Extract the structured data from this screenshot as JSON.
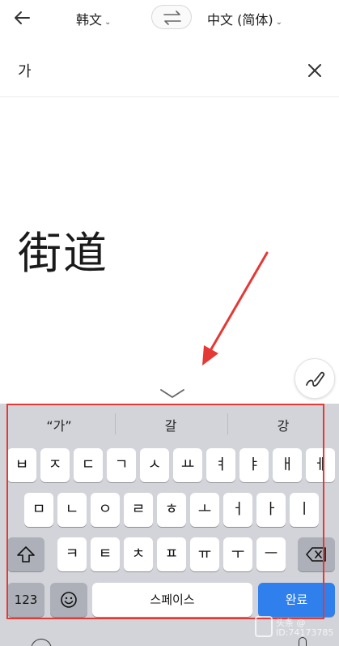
{
  "header": {
    "source_lang": "韩文",
    "target_lang": "中文 (简体)"
  },
  "input": {
    "text": "가"
  },
  "result": {
    "text": "街道"
  },
  "keyboard": {
    "suggestions": [
      "“가”",
      "갈",
      "강"
    ],
    "row1": [
      "ㅂ",
      "ㅈ",
      "ㄷ",
      "ㄱ",
      "ㅅ",
      "ㅛ",
      "ㅕ",
      "ㅑ",
      "ㅐ",
      "ㅔ"
    ],
    "row2": [
      "ㅁ",
      "ㄴ",
      "ㅇ",
      "ㄹ",
      "ㅎ",
      "ㅗ",
      "ㅓ",
      "ㅏ",
      "ㅣ"
    ],
    "row3": [
      "ㅋ",
      "ㅌ",
      "ㅊ",
      "ㅍ",
      "ㅠ",
      "ㅜ",
      "ㅡ"
    ],
    "numbers_label": "123",
    "space_label": "스페이스",
    "done_label": "완료"
  },
  "watermark": {
    "line1": "头条 @",
    "line2": "ID:74173785"
  },
  "colors": {
    "accent": "#2f80ed",
    "annotation": "#e53935"
  }
}
